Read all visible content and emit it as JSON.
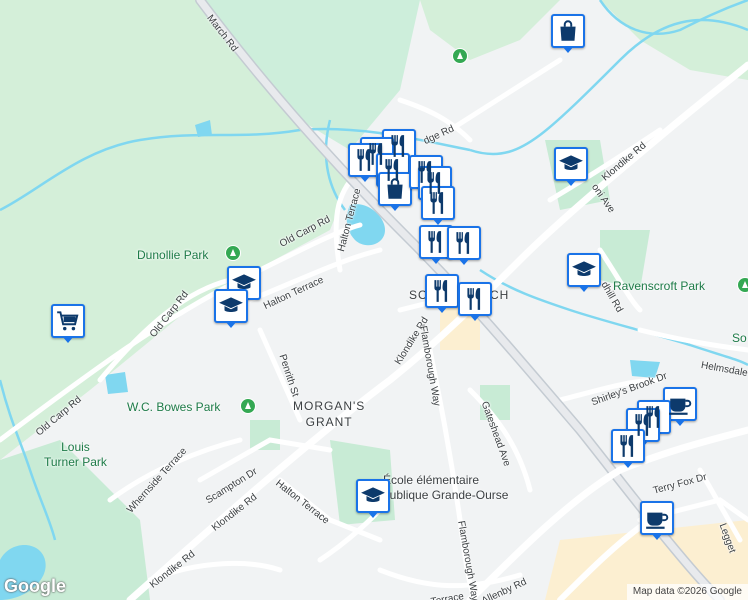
{
  "map": {
    "neighbourhood": "MORGAN'S\nGRANT",
    "area_label": "SOUTH MARCH",
    "google_logo": "Google",
    "attribution": "Map data ©2026 Google",
    "colors": {
      "background": "#f1f3f4",
      "park": "#c8ebd5",
      "woods": "#d4efd9",
      "water": "#80d7f0",
      "road": "#ffffff",
      "major_road": "#c4cbd2",
      "marker_border": "#1a73e8",
      "marker_icon": "#0d3a6c",
      "commercial": "#fcefd1"
    }
  },
  "roads": [
    {
      "name": "March Rd"
    },
    {
      "name": "Old Carp Rd"
    },
    {
      "name": "Old Carp Rd"
    },
    {
      "name": "Old Carp Rd"
    },
    {
      "name": "Halton Terrace"
    },
    {
      "name": "Halton Terrace"
    },
    {
      "name": "Halton Terrace"
    },
    {
      "name": "Klondike Rd"
    },
    {
      "name": "Klondike Rd"
    },
    {
      "name": "Klondike Rd"
    },
    {
      "name": "Klondike Rd"
    },
    {
      "name": "Flamborough Way"
    },
    {
      "name": "Flamborough Way"
    },
    {
      "name": "Penrith St"
    },
    {
      "name": "Whernside Terrace"
    },
    {
      "name": "Scampton Dr"
    },
    {
      "name": "Gateshead Ave"
    },
    {
      "name": "Shirley's Brook Dr"
    },
    {
      "name": "Terry Fox Dr"
    },
    {
      "name": "Helmsdale"
    },
    {
      "name": "Allenby Rd"
    },
    {
      "name": "dhill Rd"
    },
    {
      "name": "oni Ave"
    },
    {
      "name": "dge Rd"
    },
    {
      "name": "Legget"
    },
    {
      "name": "Terrace"
    }
  ],
  "parks": [
    {
      "name": "Dunollie Park"
    },
    {
      "name": "W.C. Bowes Park"
    },
    {
      "name": "Louis\nTurner Park"
    },
    {
      "name": "Ravenscroft Park"
    },
    {
      "name": "So"
    }
  ],
  "school_label": "École élémentaire\npublique Grande-Ourse",
  "markers": [
    {
      "kind": "shopping-bag",
      "label": "shopping"
    },
    {
      "kind": "shopping-cart",
      "label": "grocery"
    },
    {
      "kind": "school",
      "label": "school"
    },
    {
      "kind": "school",
      "label": "school"
    },
    {
      "kind": "school",
      "label": "school"
    },
    {
      "kind": "school",
      "label": "school"
    },
    {
      "kind": "school",
      "label": "school"
    },
    {
      "kind": "restaurant",
      "label": "restaurant"
    },
    {
      "kind": "restaurant",
      "label": "restaurant"
    },
    {
      "kind": "restaurant",
      "label": "restaurant"
    },
    {
      "kind": "restaurant",
      "label": "restaurant"
    },
    {
      "kind": "shopping-bag",
      "label": "shopping"
    },
    {
      "kind": "restaurant",
      "label": "restaurant"
    },
    {
      "kind": "restaurant",
      "label": "restaurant"
    },
    {
      "kind": "restaurant",
      "label": "restaurant"
    },
    {
      "kind": "restaurant",
      "label": "restaurant"
    },
    {
      "kind": "restaurant",
      "label": "restaurant"
    },
    {
      "kind": "restaurant",
      "label": "restaurant"
    },
    {
      "kind": "coffee",
      "label": "cafe"
    },
    {
      "kind": "restaurant",
      "label": "restaurant"
    },
    {
      "kind": "restaurant",
      "label": "restaurant"
    },
    {
      "kind": "restaurant",
      "label": "restaurant"
    },
    {
      "kind": "coffee",
      "label": "cafe"
    }
  ]
}
